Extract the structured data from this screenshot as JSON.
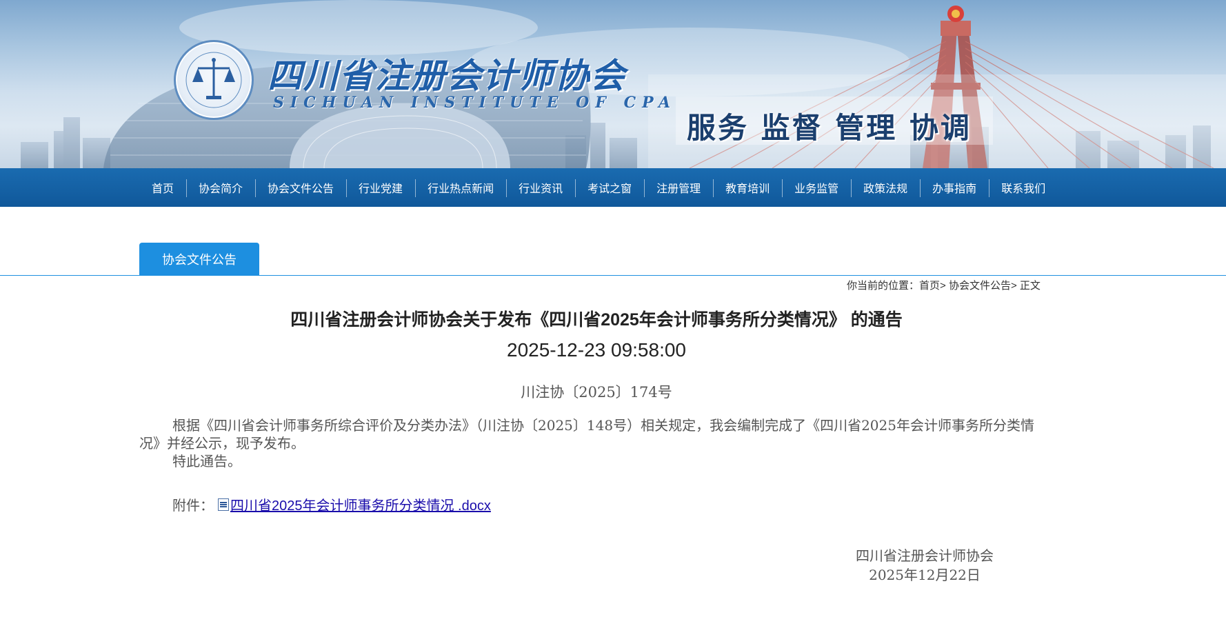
{
  "banner": {
    "org_name": "四川省注册会计师协会",
    "org_name_en": "SICHUAN INSTITUTE OF CPA",
    "badge_text": "SICHUAN INSTITUTE OF CERTIFIED PUBLIC ACCOUNTANTS",
    "slogan": "服务 监督 管理 协调"
  },
  "nav": {
    "items": [
      "首页",
      "协会简介",
      "协会文件公告",
      "行业党建",
      "行业热点新闻",
      "行业资讯",
      "考试之窗",
      "注册管理",
      "教育培训",
      "业务监管",
      "政策法规",
      "办事指南",
      "联系我们"
    ]
  },
  "tab": {
    "label": "协会文件公告"
  },
  "breadcrumb": {
    "prefix": "你当前的位置：",
    "home": "首页",
    "sep1": "> ",
    "section": "协会文件公告",
    "sep2": "> ",
    "current": "正文"
  },
  "article": {
    "title": "四川省注册会计师协会关于发布《四川省2025年会计师事务所分类情况》 的通告",
    "datetime": "2025-12-23 09:58:00",
    "doc_number": "川注协〔2025〕174号",
    "paragraph1": "根据《四川省会计师事务所综合评价及分类办法》（川注协〔2025〕148号）相关规定，我会编制完成了《四川省2025年会计师事务所分类情况》并经公示，现予发布。",
    "paragraph2": "特此通告。",
    "attachment_label": "附件：",
    "attachment_name": "四川省2025年会计师事务所分类情况 .docx",
    "signature_org": "四川省注册会计师协会",
    "signature_date": "2025年12月22日"
  }
}
